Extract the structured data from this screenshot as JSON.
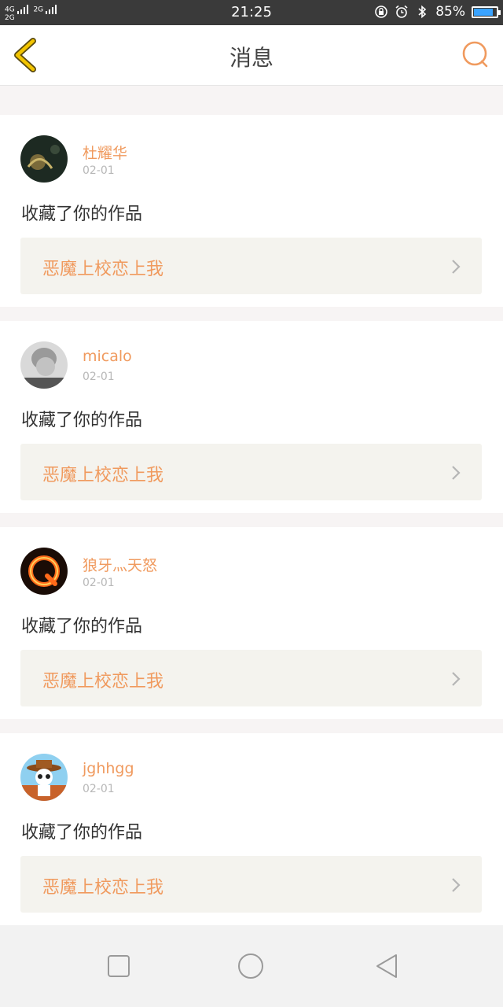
{
  "status_bar": {
    "network_left": "4G",
    "network_left_2": "2G",
    "network_right": "2G",
    "time": "21:25",
    "battery_percent": "85%",
    "battery_level": 0.85,
    "battery_color": "#3aa3ff"
  },
  "header": {
    "title": "消息",
    "back_icon": "chevron-left-icon",
    "search_icon": "search-icon",
    "accent_back": "#f2c400",
    "accent_search": "#f09a5e"
  },
  "messages": [
    {
      "user": "杜耀华",
      "date": "02-01",
      "action": "收藏了你的作品",
      "work_title": "恶魔上校恋上我",
      "avatar_style": "dark-photo"
    },
    {
      "user": "micalo",
      "date": "02-01",
      "action": "收藏了你的作品",
      "work_title": "恶魔上校恋上我",
      "avatar_style": "grey-photo"
    },
    {
      "user": "狼牙灬天怒",
      "date": "02-01",
      "action": "收藏了你的作品",
      "work_title": "恶魔上校恋上我",
      "avatar_style": "fire-q"
    },
    {
      "user": "jghhgg",
      "date": "02-01",
      "action": "收藏了你的作品",
      "work_title": "恶魔上校恋上我",
      "avatar_style": "cartoon-panda"
    }
  ],
  "colors": {
    "accent": "#f09a5e",
    "card_bg": "#ffffff",
    "link_bg": "#f4f3ee"
  }
}
